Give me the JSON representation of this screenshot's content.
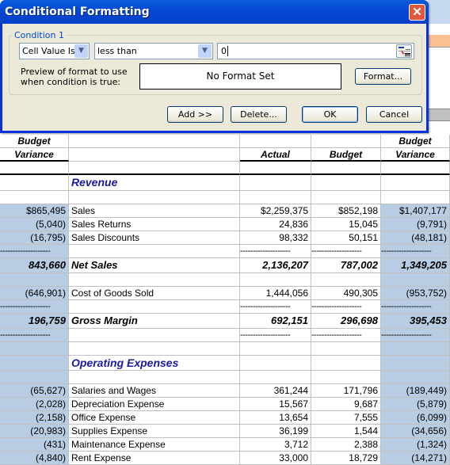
{
  "dialog": {
    "title": "Conditional Formatting",
    "close_icon": "close-x-icon",
    "condition_label": "Condition 1",
    "condition_type": "Cell Value Is",
    "operator": "less than",
    "value": "0",
    "preview_label_line1": "Preview of format to use",
    "preview_label_line2": "when condition is true:",
    "preview_text": "No Format Set",
    "format_button": "Format...",
    "add_button": "Add >>",
    "delete_button": "Delete...",
    "ok_button": "OK",
    "cancel_button": "Cancel"
  },
  "sheet": {
    "left_header": [
      "Budget",
      "Variance"
    ],
    "headers": {
      "actual": "Actual",
      "budget": "Budget",
      "variance1": "Budget",
      "variance2": "Variance"
    },
    "sections": {
      "revenue": "Revenue",
      "operating": "Operating Expenses"
    },
    "dash": "--------------------",
    "rows": {
      "sales": {
        "left": "$865,495",
        "label": "Sales",
        "actual": "$2,259,375",
        "budget": "$852,198",
        "variance": "$1,407,177"
      },
      "returns": {
        "left": "(5,040)",
        "label": "Sales Returns",
        "actual": "24,836",
        "budget": "15,045",
        "variance": "(9,791)"
      },
      "discounts": {
        "left": "(16,795)",
        "label": "Sales Discounts",
        "actual": "98,332",
        "budget": "50,151",
        "variance": "(48,181)"
      },
      "net_sales": {
        "left": "843,660",
        "label": "Net Sales",
        "actual": "2,136,207",
        "budget": "787,002",
        "variance": "1,349,205"
      },
      "cogs": {
        "left": "(646,901)",
        "label": "Cost of Goods Sold",
        "actual": "1,444,056",
        "budget": "490,305",
        "variance": "(953,752)"
      },
      "gross_margin": {
        "left": "196,759",
        "label": "Gross Margin",
        "actual": "692,151",
        "budget": "296,698",
        "variance": "395,453"
      },
      "salaries": {
        "left": "(65,627)",
        "label": "Salaries and Wages",
        "actual": "361,244",
        "budget": "171,796",
        "variance": "(189,449)"
      },
      "depreciation": {
        "left": "(2,028)",
        "label": "Depreciation Expense",
        "actual": "15,567",
        "budget": "9,687",
        "variance": "(5,879)"
      },
      "office": {
        "left": "(2,158)",
        "label": "Office Expense",
        "actual": "13,654",
        "budget": "7,555",
        "variance": "(6,099)"
      },
      "supplies": {
        "left": "(20,983)",
        "label": "Supplies Expense",
        "actual": "36,199",
        "budget": "1,544",
        "variance": "(34,656)"
      },
      "maintenance": {
        "left": "(431)",
        "label": "Maintenance Expense",
        "actual": "3,712",
        "budget": "2,388",
        "variance": "(1,324)"
      },
      "rent": {
        "left": "(4,840)",
        "label": "Rent Expense",
        "actual": "33,000",
        "budget": "18,729",
        "variance": "(14,271)"
      }
    }
  }
}
